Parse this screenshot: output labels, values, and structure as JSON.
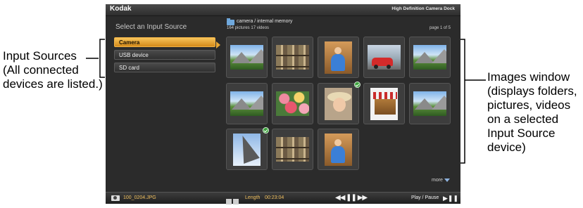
{
  "annotations": {
    "left": {
      "label_line1": "Input Sources",
      "label_line2": "(All connected",
      "label_line3": "devices are listed.)"
    },
    "right": {
      "label_line1": "Images window",
      "label_line2": "(displays folders,",
      "label_line3": "pictures, videos",
      "label_line4": "on a selected",
      "label_line5": "Input Source",
      "label_line6": "device)"
    }
  },
  "screen": {
    "brand": "Kodak",
    "dock_title": "High Definition Camera Dock",
    "sources": {
      "heading": "Select an Input Source",
      "items": [
        {
          "label": "Camera",
          "selected": true
        },
        {
          "label": "USB device",
          "selected": false
        },
        {
          "label": "SD card",
          "selected": false
        }
      ]
    },
    "browser": {
      "path": "camera / internal memory",
      "counts": "164 pictures  17 videos",
      "page": "page 1 of 5",
      "more_label": "more",
      "thumbnails": [
        {
          "subject": "mountain-valley",
          "checked": false
        },
        {
          "subject": "postcard-display",
          "checked": false
        },
        {
          "subject": "girl-blue-dress",
          "checked": false
        },
        {
          "subject": "red-car",
          "checked": false
        },
        {
          "subject": "mountain-valley",
          "checked": false
        },
        {
          "subject": "mountain-valley",
          "checked": false
        },
        {
          "subject": "roses",
          "checked": false
        },
        {
          "subject": "girl-with-hat",
          "checked": true
        },
        {
          "subject": "market-stall",
          "checked": false
        },
        {
          "subject": "mountain-valley",
          "checked": false
        },
        {
          "subject": "eiffel-tower",
          "checked": true
        },
        {
          "subject": "postcard-display",
          "checked": false
        },
        {
          "subject": "girl-blue-dress",
          "checked": false
        }
      ]
    },
    "footer": {
      "filename": "100_0204.JPG",
      "length_label": "Length",
      "length_value": "00:23:04",
      "play_pause_label": "Play / Pause"
    }
  },
  "colors": {
    "accent": "#e8a633",
    "screen_bg": "#2b2b2b",
    "check": "#3aa23a"
  }
}
